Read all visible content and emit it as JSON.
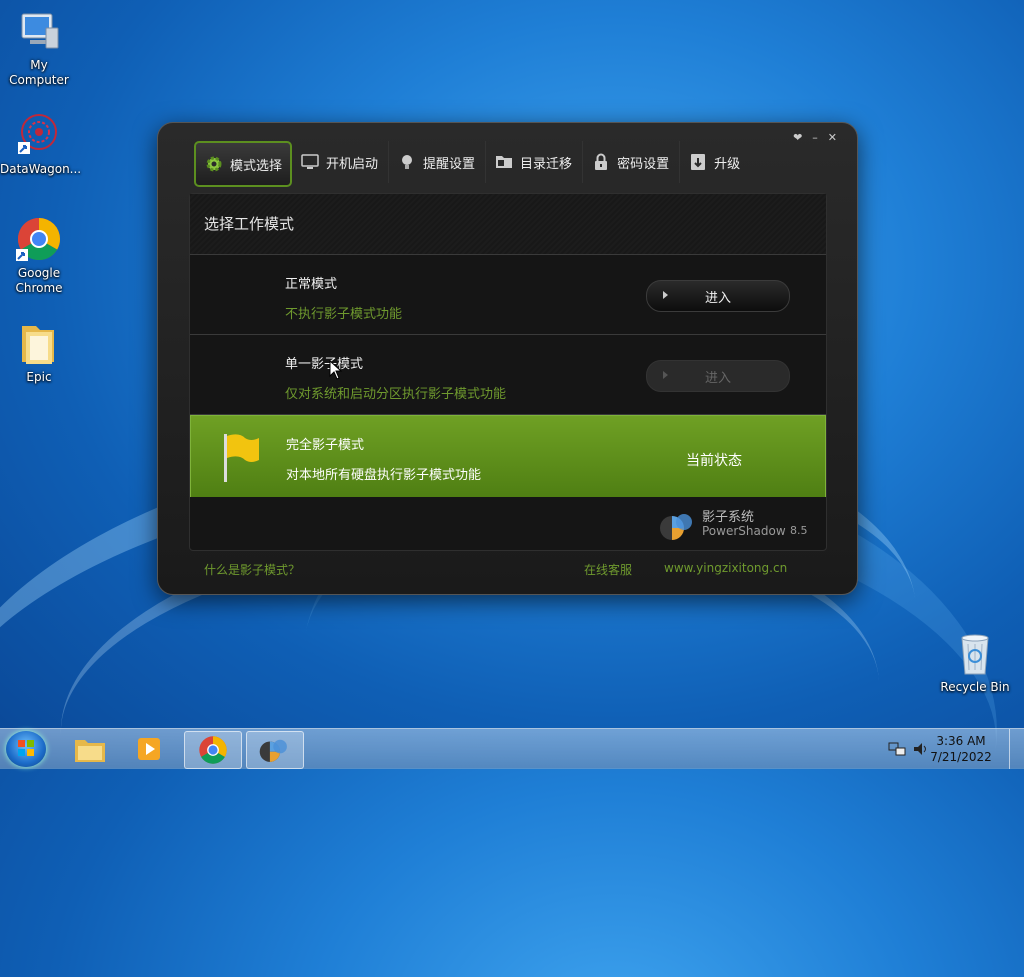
{
  "desktop": {
    "icons": [
      {
        "label": "My Computer",
        "icon": "computer-icon"
      },
      {
        "label": "DataWagon...",
        "icon": "datawagon-icon"
      },
      {
        "label": "Google Chrome",
        "icon": "chrome-icon"
      },
      {
        "label": "Epic",
        "icon": "folder-icon"
      },
      {
        "label": "Recycle Bin",
        "icon": "recycle-bin-icon"
      }
    ]
  },
  "window": {
    "controls": [
      "❤",
      "–",
      "✕"
    ],
    "tabs": [
      {
        "label": "模式选择",
        "icon": "gear-icon",
        "active": true
      },
      {
        "label": "开机启动",
        "icon": "monitor-icon"
      },
      {
        "label": "提醒设置",
        "icon": "lightbulb-icon"
      },
      {
        "label": "目录迁移",
        "icon": "folder-move-icon"
      },
      {
        "label": "密码设置",
        "icon": "lock-icon"
      },
      {
        "label": "升级",
        "icon": "upgrade-icon"
      }
    ],
    "panel_title": "选择工作模式",
    "modes": [
      {
        "title": "正常模式",
        "desc": "不执行影子模式功能",
        "button": "进入",
        "enabled": true
      },
      {
        "title": "单一影子模式",
        "desc": "仅对系统和启动分区执行影子模式功能",
        "button": "进入",
        "enabled": false
      },
      {
        "title": "完全影子模式",
        "desc": "对本地所有硬盘执行影子模式功能",
        "state": "当前状态",
        "current": true
      }
    ],
    "brand": {
      "name": "影子系统",
      "product": "PowerShadow",
      "version": "8.5"
    },
    "footer": {
      "help": "什么是影子模式？",
      "service": "在线客服",
      "site": "www.yingzixitong.cn"
    }
  },
  "taskbar": {
    "time": "3:36 AM",
    "date": "7/21/2022"
  },
  "colors": {
    "accent_green": "#5c8f1f",
    "link_green": "#6f9a2e"
  }
}
